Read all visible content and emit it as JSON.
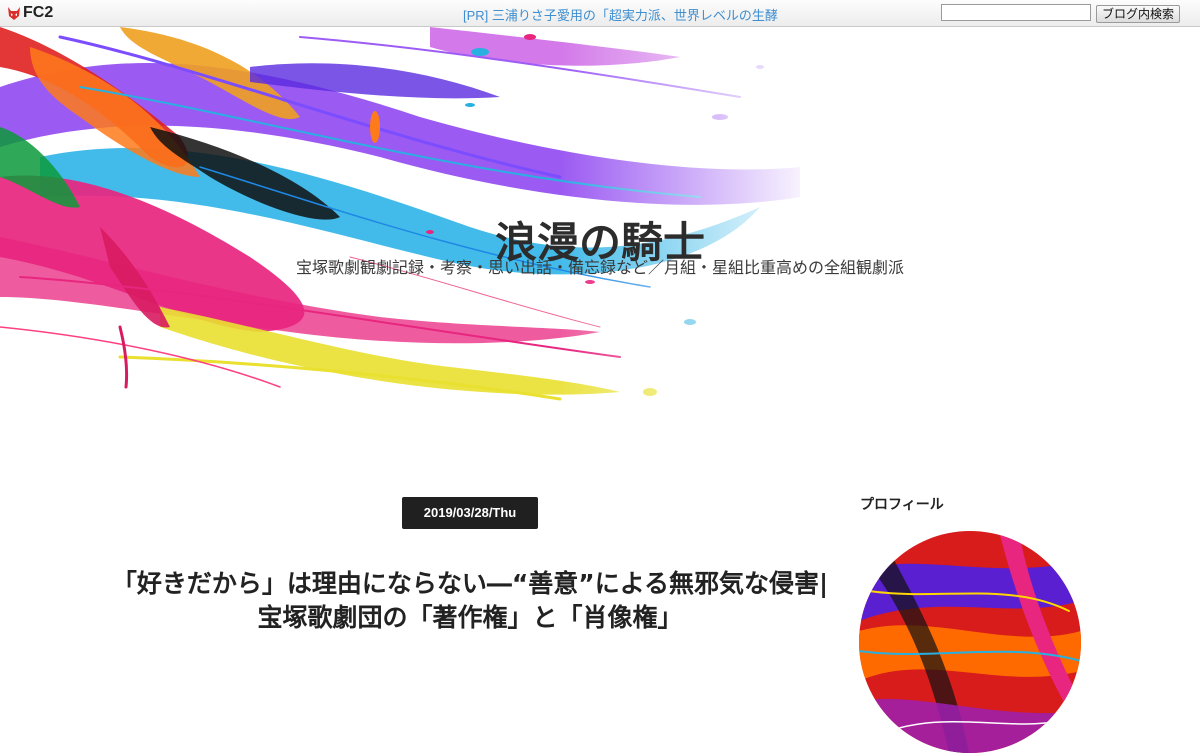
{
  "topbar": {
    "brand": "FC2",
    "pr_link": "[PR] 三浦りさ子愛用の「超実力派、世界レベルの生酵",
    "search_placeholder": "",
    "search_button": "ブログ内検索"
  },
  "header": {
    "title": "浪漫の騎士",
    "description": "宝塚歌劇観劇記録・考察・思い出話・備忘録など／月組・星組比重高めの全組観劇派"
  },
  "article": {
    "date": "2019/03/28/Thu",
    "title": "「好きだから」は理由にならない―“善意”による無邪気な侵害|宝塚歌劇団の「著作権」と「肖像権」"
  },
  "sidebar": {
    "profile_heading": "プロフィール"
  },
  "icons": {
    "logo": "fc2-fox-logo-icon"
  },
  "colors": {
    "pr_link": "#3e8ed0",
    "date_badge": "#202020",
    "title_text": "#2c2c2c"
  }
}
